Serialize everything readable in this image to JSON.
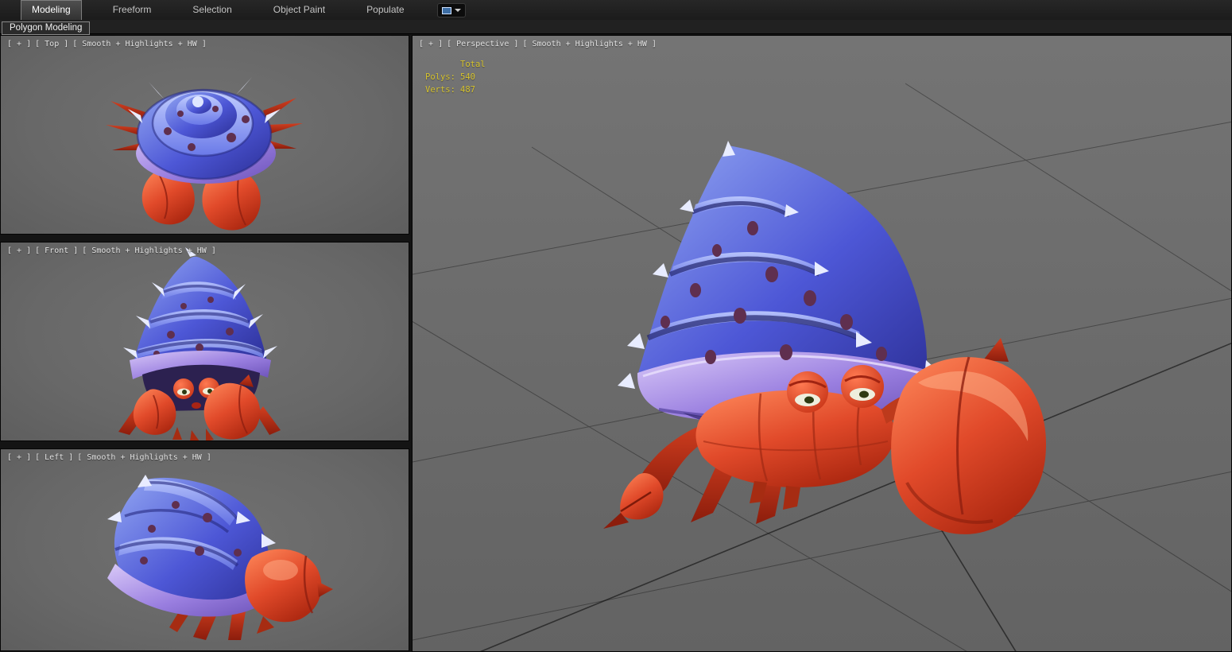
{
  "ribbon": {
    "tabs": [
      {
        "label": "Modeling",
        "active": true
      },
      {
        "label": "Freeform",
        "active": false
      },
      {
        "label": "Selection",
        "active": false
      },
      {
        "label": "Object Paint",
        "active": false
      },
      {
        "label": "Populate",
        "active": false
      }
    ],
    "panel_label": "Polygon Modeling"
  },
  "viewports": {
    "top": {
      "plus": "[ + ]",
      "view": "[ Top ]",
      "shading": "[ Smooth + Highlights + HW ]"
    },
    "front": {
      "plus": "[ + ]",
      "view": "[ Front ]",
      "shading": "[ Smooth + Highlights + HW ]"
    },
    "left": {
      "plus": "[ + ]",
      "view": "[ Left ]",
      "shading": "[ Smooth + Highlights + HW ]"
    },
    "perspective": {
      "plus": "[ + ]",
      "view": "[ Perspective ]",
      "shading": "[ Smooth + Highlights + HW ]"
    }
  },
  "stats": {
    "title": "Total",
    "polys_label": "Polys:",
    "polys_value": "540",
    "verts_label": "Verts:",
    "verts_value": "487"
  },
  "colors": {
    "shell_blue": "#4d57d6",
    "shell_rim": "#9a7fe0",
    "crab_red": "#e14a2a",
    "stats_yellow": "#d6c32e",
    "viewport_gray": "#696969"
  }
}
